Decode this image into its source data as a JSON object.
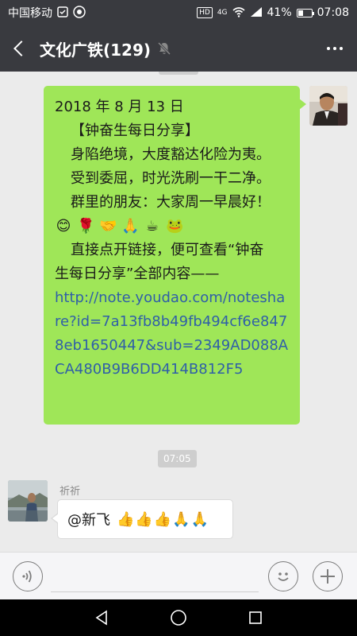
{
  "status_bar": {
    "carrier": "中国移动",
    "network_badge": "HD",
    "signal_label": "4G",
    "battery": "41%",
    "time": "07:08",
    "battery_level": 0.41
  },
  "header": {
    "title": "文化广铁(129)",
    "back_icon": "chevron-left-icon",
    "mute_icon": "bell-mute-icon",
    "more_icon": "more-dots-icon"
  },
  "messages": {
    "green": {
      "date_line": "2018 年 8 月 13 日",
      "heading": "【钟奋生每日分享】",
      "line1": "身陷绝境，大度豁达化险为夷。",
      "line2": "受到委屈，时光洗刷一干二净。",
      "line3": "群里的朋友：大家周一早晨好！",
      "emojis": [
        "😊",
        "🌹",
        "🤝",
        "🙏",
        "☕",
        "🐸"
      ],
      "line4": "直接点开链接，便可查看“钟奋",
      "line5": "生每日分享”全部内容——",
      "link": "http://note.youdao.com/noteshare?id=7a13fb8b49fb494cf6e8478eb1650447&sub=2349AD088ACA480B9B6DD414B812F5"
    },
    "time_divider": "07:05",
    "white": {
      "sender": "祈祈",
      "text": "@新飞",
      "reactions": "👍👍👍🙏🙏"
    }
  },
  "input": {
    "placeholder": ""
  }
}
